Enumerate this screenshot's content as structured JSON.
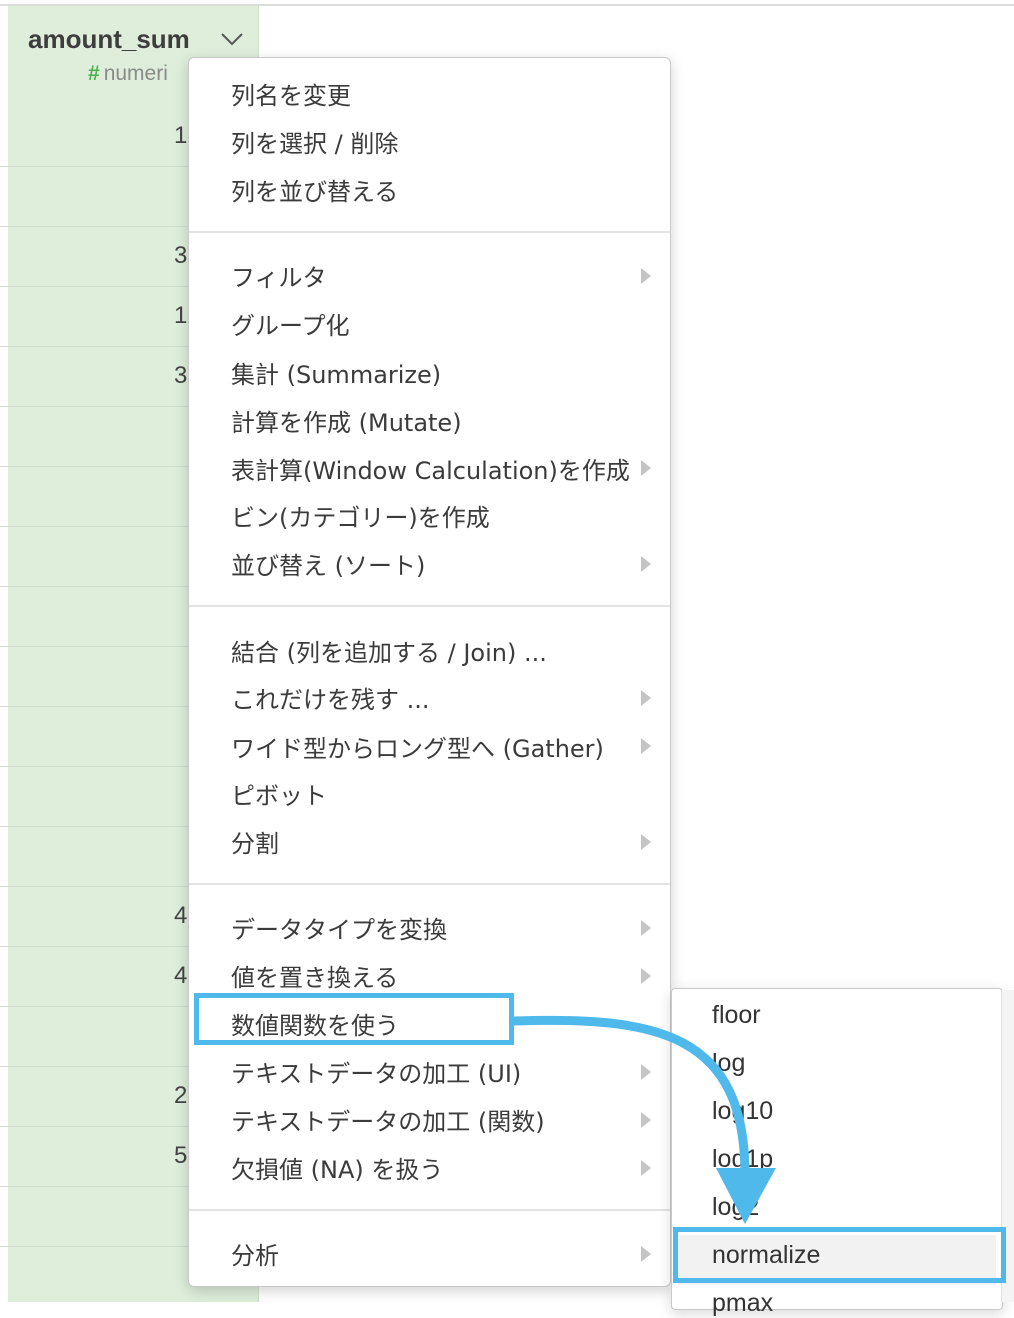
{
  "column": {
    "title": "amount_sum",
    "type_symbol": "#",
    "type_label": "numeri",
    "cells": [
      "1",
      "3",
      "1",
      "3",
      "4",
      "4",
      "2",
      "5"
    ]
  },
  "menu": {
    "group1": [
      "列名を変更",
      "列を選択 / 削除",
      "列を並び替える"
    ],
    "group2": [
      "フィルタ",
      "グループ化",
      "集計 (Summarize)",
      "計算を作成 (Mutate)",
      "表計算(Window Calculation)を作成",
      "ビン(カテゴリー)を作成",
      "並び替え (ソート)"
    ],
    "group3": [
      "結合 (列を追加する / Join) ...",
      "これだけを残す ...",
      "ワイド型からロング型へ (Gather)",
      "ピボット",
      "分割"
    ],
    "group4": [
      "データタイプを変換",
      "値を置き換える",
      "数値関数を使う",
      "テキストデータの加工 (UI)",
      "テキストデータの加工 (関数)",
      "欠損値 (NA) を扱う"
    ],
    "group5": [
      "分析"
    ]
  },
  "submenu": {
    "items": [
      "floor",
      "log",
      "log10",
      "log1p",
      "log2",
      "normalize",
      "pmax"
    ],
    "selected": "normalize"
  },
  "colors": {
    "highlight": "#4fb9ec",
    "column_bg": "#deeedb",
    "type_hash": "#4caf50"
  }
}
